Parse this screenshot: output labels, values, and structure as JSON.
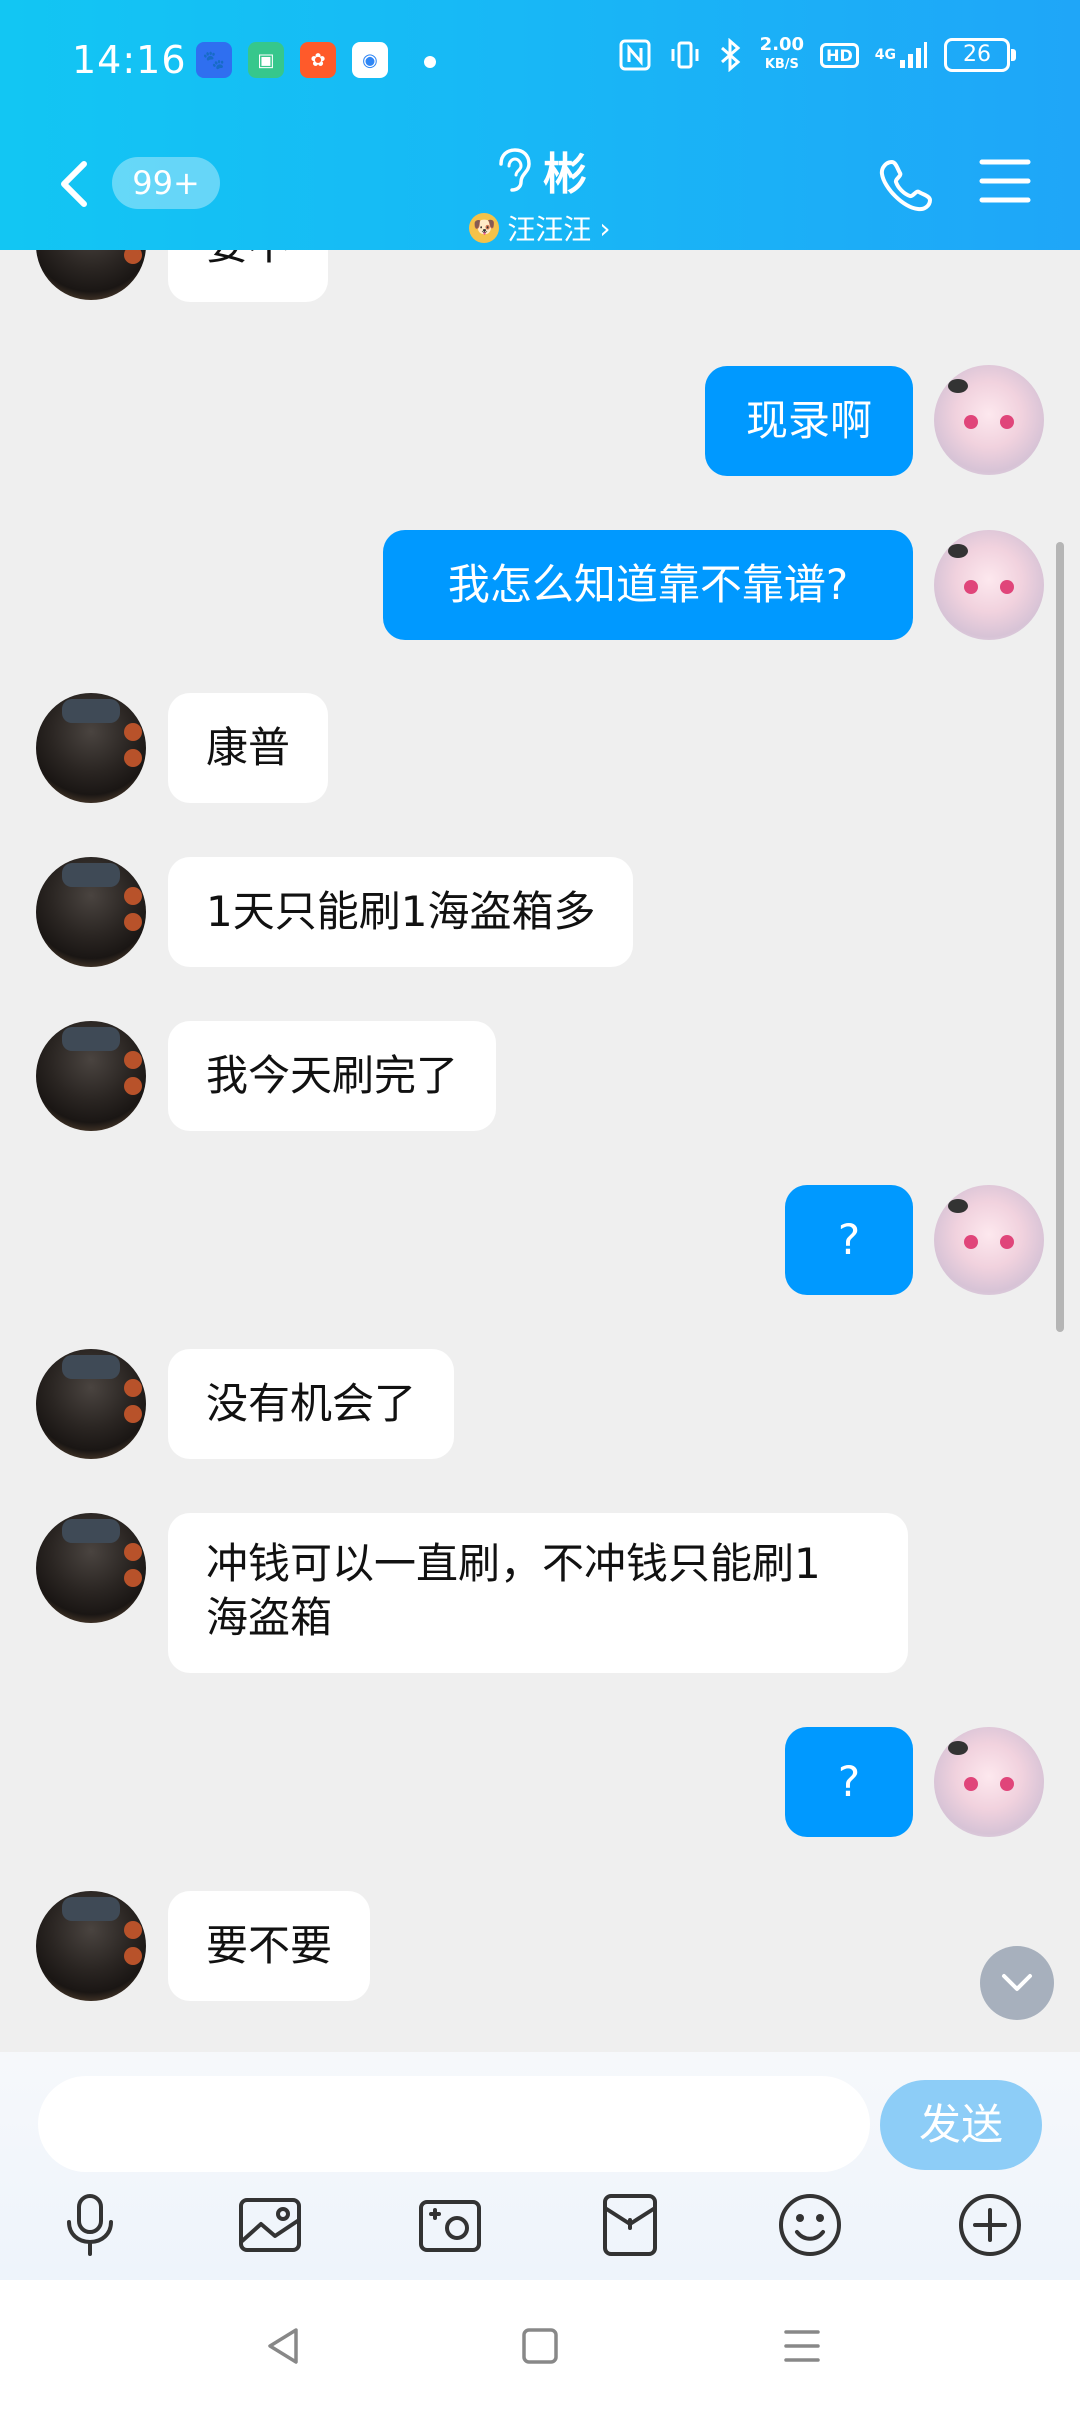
{
  "status_bar": {
    "time": "14:16",
    "speed_top": "2.00",
    "speed_bottom": "KB/S",
    "hd": "HD",
    "net": "4G",
    "battery": "26"
  },
  "header": {
    "unread_badge": "99+",
    "title": "彬",
    "subtitle": "汪汪汪",
    "subtitle_chevron": "›"
  },
  "messages": [
    {
      "side": "left",
      "text": "要不"
    },
    {
      "side": "right",
      "text": "现录啊"
    },
    {
      "side": "right",
      "text": "我怎么知道靠不靠谱?"
    },
    {
      "side": "left",
      "text": "康普"
    },
    {
      "side": "left",
      "text": "1天只能刷1海盗箱多"
    },
    {
      "side": "left",
      "text": "我今天刷完了"
    },
    {
      "side": "right",
      "text": "?"
    },
    {
      "side": "left",
      "text": "没有机会了"
    },
    {
      "side": "left",
      "text_line1": "冲钱可以一直刷，不冲钱只能刷1",
      "text_line2": "海盗箱"
    },
    {
      "side": "right",
      "text": "?"
    },
    {
      "side": "left",
      "text": "要不要"
    }
  ],
  "input": {
    "placeholder": "",
    "send_label": "发送"
  },
  "toolbar": [
    "mic-icon",
    "image-icon",
    "camera-icon",
    "red-packet-icon",
    "emoji-icon",
    "plus-icon"
  ],
  "colors": {
    "header_start": "#12c6f3",
    "header_end": "#1fa6f8",
    "my_bubble": "#0099ff",
    "send_button": "#8dcdf7"
  }
}
